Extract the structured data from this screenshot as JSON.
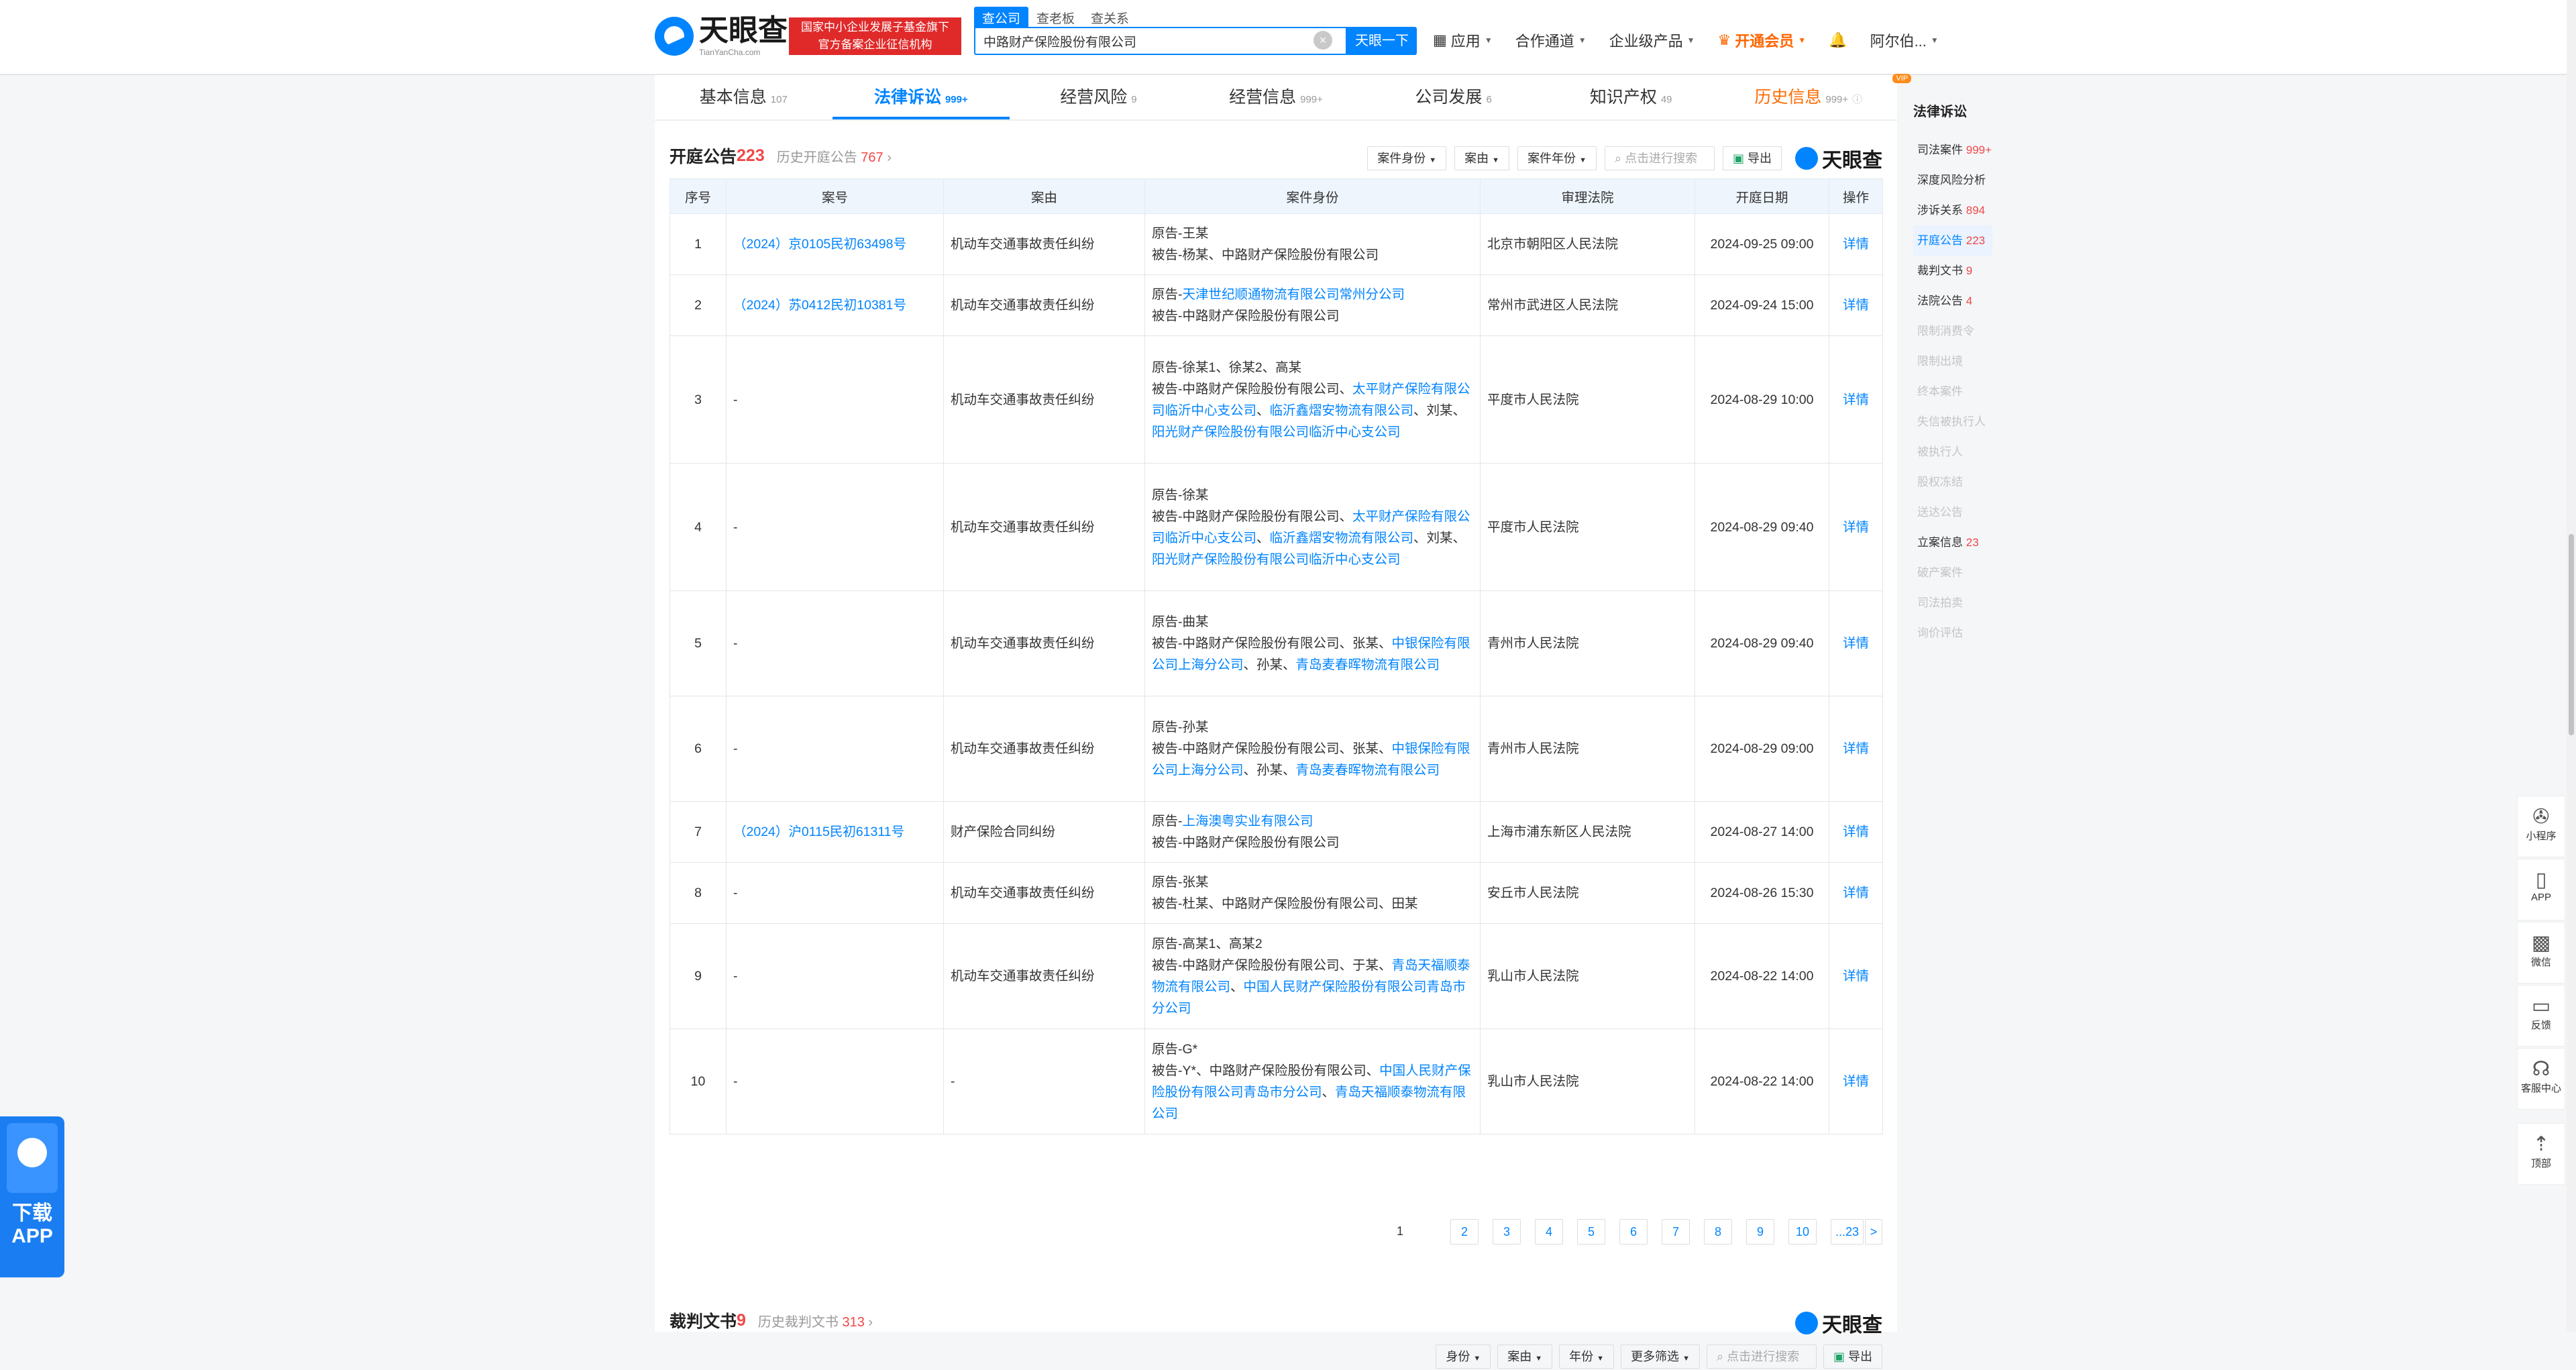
{
  "header": {
    "logo_cn": "天眼查",
    "logo_en": "TianYanCha.com",
    "gov_badge_line1": "国家中小企业发展子基金旗下",
    "gov_badge_line2": "官方备案企业征信机构",
    "search_tabs": [
      "查公司",
      "查老板",
      "查关系"
    ],
    "search_value": "中路财产保险股份有限公司",
    "search_button": "天眼一下",
    "nav": [
      "应用",
      "合作通道",
      "企业级产品",
      "开通会员",
      "阿尔伯..."
    ]
  },
  "tabs": [
    {
      "label": "基本信息",
      "count": "107"
    },
    {
      "label": "法律诉讼",
      "count": "999+"
    },
    {
      "label": "经营风险",
      "count": "9"
    },
    {
      "label": "经营信息",
      "count": "999+"
    },
    {
      "label": "公司发展",
      "count": "6"
    },
    {
      "label": "知识产权",
      "count": "49"
    },
    {
      "label": "历史信息",
      "count": "999+",
      "badge": "VIP"
    }
  ],
  "section1": {
    "title": "开庭公告",
    "count": "223",
    "history_label": "历史开庭公告",
    "history_count": "767",
    "filters": [
      "案件身份",
      "案由",
      "案件年份"
    ],
    "search_placeholder": "点击进行搜索",
    "export": "导出",
    "brand": "天眼查",
    "columns": [
      "序号",
      "案号",
      "案由",
      "案件身份",
      "审理法院",
      "开庭日期",
      "操作"
    ],
    "rows": [
      {
        "no": "1",
        "case": "（2024）京0105民初63498号",
        "cause": "机动车交通事故责任纠纷",
        "court": "北京市朝阳区人民法院",
        "date": "2024-09-25 09:00",
        "op": "详情"
      },
      {
        "no": "2",
        "case": "（2024）苏0412民初10381号",
        "cause": "机动车交通事故责任纠纷",
        "court": "常州市武进区人民法院",
        "date": "2024-09-24 15:00",
        "op": "详情"
      },
      {
        "no": "3",
        "case": "-",
        "cause": "机动车交通事故责任纠纷",
        "court": "平度市人民法院",
        "date": "2024-08-29 10:00",
        "op": "详情"
      },
      {
        "no": "4",
        "case": "-",
        "cause": "机动车交通事故责任纠纷",
        "court": "平度市人民法院",
        "date": "2024-08-29 09:40",
        "op": "详情"
      },
      {
        "no": "5",
        "case": "-",
        "cause": "机动车交通事故责任纠纷",
        "court": "青州市人民法院",
        "date": "2024-08-29 09:40",
        "op": "详情"
      },
      {
        "no": "6",
        "case": "-",
        "cause": "机动车交通事故责任纠纷",
        "court": "青州市人民法院",
        "date": "2024-08-29 09:00",
        "op": "详情"
      },
      {
        "no": "7",
        "case": "（2024）沪0115民初61311号",
        "cause": "财产保险合同纠纷",
        "court": "上海市浦东新区人民法院",
        "date": "2024-08-27 14:00",
        "op": "详情"
      },
      {
        "no": "8",
        "case": "-",
        "cause": "机动车交通事故责任纠纷",
        "court": "安丘市人民法院",
        "date": "2024-08-26 15:30",
        "op": "详情"
      },
      {
        "no": "9",
        "case": "-",
        "cause": "机动车交通事故责任纠纷",
        "court": "乳山市人民法院",
        "date": "2024-08-22 14:00",
        "op": "详情"
      },
      {
        "no": "10",
        "case": "-",
        "cause": "-",
        "court": "乳山市人民法院",
        "date": "2024-08-22 14:00",
        "op": "详情"
      }
    ],
    "parties": {
      "p1": "原告-王某",
      "p1b": "被告-杨某、中路财产保险股份有限公司",
      "p2a": "原告-",
      "p2a_link": "天津世纪顺通物流有限公司常州分公司",
      "p2b": "被告-中路财产保险股份有限公司",
      "p3a": "原告-徐某1、徐某2、高某",
      "p3b": "被告-中路财产保险股份有限公司、",
      "p3_l1": "太平财产保险有限公司临沂中心支公司",
      "p3_s1": "、",
      "p3_l2": "临沂鑫熠安物流有限公司",
      "p3_s2": "、刘某、",
      "p3_l3": "阳光财产保险股份有限公司临沂中心支公司",
      "p4a": "原告-徐某",
      "p4b": "被告-中路财产保险股份有限公司、",
      "p4_l1": "太平财产保险有限公司临沂中心支公司",
      "p4_s1": "、",
      "p4_l2": "临沂鑫熠安物流有限公司",
      "p4_s2": "、刘某、",
      "p4_l3": "阳光财产保险股份有限公司临沂中心支公司",
      "p5a": "原告-曲某",
      "p5b": "被告-中路财产保险股份有限公司、张某、",
      "p5_l1": "中银保险有限公司上海分公司",
      "p5_s1": "、孙某、",
      "p5_l2": "青岛麦春晖物流有限公司",
      "p6a": "原告-孙某",
      "p6b": "被告-中路财产保险股份有限公司、张某、",
      "p6_l1": "中银保险有限公司上海分公司",
      "p6_s1": "、孙某、",
      "p6_l2": "青岛麦春晖物流有限公司",
      "p7a": "原告-",
      "p7a_link": "上海澳粤实业有限公司",
      "p7b": "被告-中路财产保险股份有限公司",
      "p8a": "原告-张某",
      "p8b": "被告-杜某、中路财产保险股份有限公司、田某",
      "p9a": "原告-高某1、高某2",
      "p9b": "被告-中路财产保险股份有限公司、于某、",
      "p9_l1": "青岛天福顺泰物流有限公司",
      "p9_s1": "、",
      "p9_l2": "中国人民财产保险股份有限公司青岛市分公司",
      "p10a": "原告-G*",
      "p10b": "被告-Y*、中路财产保险股份有限公司、",
      "p10_l1": "中国人民财产保险股份有限公司青岛市分公司",
      "p10_s1": "、",
      "p10_l2": "青岛天福顺泰物流有限公司"
    },
    "pagination": [
      "1",
      "2",
      "3",
      "4",
      "5",
      "6",
      "7",
      "8",
      "9",
      "10",
      "...23",
      ">"
    ]
  },
  "section2": {
    "title": "裁判文书",
    "count": "9",
    "history_label": "历史裁判文书",
    "history_count": "313",
    "brand": "天眼查",
    "filters": [
      "身份",
      "案由",
      "年份",
      "更多筛选"
    ],
    "search_placeholder": "点击进行搜索",
    "export": "导出"
  },
  "sidebar": {
    "title": "法律诉讼",
    "items": [
      {
        "label": "司法案件",
        "count": "999+"
      },
      {
        "label": "深度风险分析",
        "count": ""
      },
      {
        "label": "涉诉关系",
        "count": "894"
      },
      {
        "label": "开庭公告",
        "count": "223"
      },
      {
        "label": "裁判文书",
        "count": "9"
      },
      {
        "label": "法院公告",
        "count": "4"
      },
      {
        "label": "限制消费令",
        "count": ""
      },
      {
        "label": "限制出境",
        "count": ""
      },
      {
        "label": "终本案件",
        "count": ""
      },
      {
        "label": "失信被执行人",
        "count": ""
      },
      {
        "label": "被执行人",
        "count": ""
      },
      {
        "label": "股权冻结",
        "count": ""
      },
      {
        "label": "送达公告",
        "count": ""
      },
      {
        "label": "立案信息",
        "count": "23"
      },
      {
        "label": "破产案件",
        "count": ""
      },
      {
        "label": "司法拍卖",
        "count": ""
      },
      {
        "label": "询价评估",
        "count": ""
      }
    ]
  },
  "float_tools": [
    "小程序",
    "APP",
    "微信",
    "反馈",
    "客服中心",
    "顶部"
  ],
  "download_app": {
    "line1": "下载",
    "line2": "APP"
  }
}
